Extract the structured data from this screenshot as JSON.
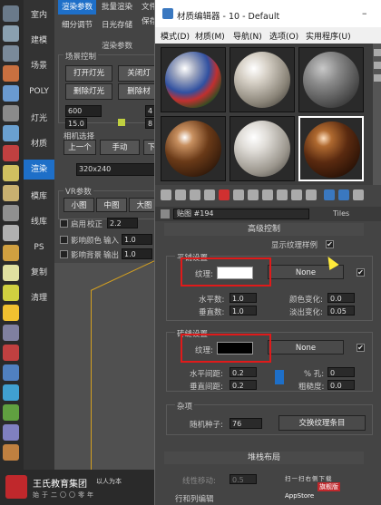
{
  "category_tabs": [
    "室内",
    "建模",
    "场景",
    "POLY",
    "灯光",
    "材质",
    "渲染",
    "模库",
    "线库",
    "PS",
    "复制",
    "清理"
  ],
  "render_panel": {
    "tabs": [
      "渲染参数",
      "批量渲染",
      "文件保存"
    ],
    "subtabs": [
      "细分调节",
      "日光存储"
    ],
    "section_header": "渲染参数",
    "scene_control": "场景控制",
    "btn_open_light": "打开灯光",
    "btn_close_light": "关闭灯",
    "btn_del_light": "删除灯光",
    "btn_del_mat": "删除材",
    "field1": "600",
    "field2": "4",
    "field3": "15.0",
    "field4": "8",
    "camera_select": "相机选择",
    "btn_prev": "上一个",
    "btn_manual": "手动",
    "btn_next": "下",
    "resolution": "320x240",
    "vr_params": "VR参数",
    "btn_small": "小图",
    "btn_medium": "中图",
    "btn_large": "大图",
    "enable_label": "启用",
    "calib_label": "校正",
    "calib_value": "2.2",
    "affect_color": "影响颜色",
    "input_label": "输入",
    "input_value": "1.0",
    "affect_bg": "影响背景",
    "output_label": "输出",
    "output_value": "1.0"
  },
  "material_editor": {
    "title": "材质编辑器 - 10 - Default",
    "menus": [
      "模式(D)",
      "材质(M)",
      "导航(N)",
      "选项(O)",
      "实用程序(U)"
    ],
    "material_name": "贴图 #194",
    "map_type": "Tiles",
    "rollout_title": "高级控制",
    "show_texture_label": "显示纹理样例",
    "show_texture_checked": "✔",
    "tile_settings": {
      "header": "平铺设置",
      "texture_label": "纹理:",
      "texture_color": "#ffffff",
      "map_button": "None",
      "h_count_label": "水平数:",
      "h_count": "1.0",
      "v_count_label": "垂直数:",
      "v_count": "1.0",
      "color_var_label": "颜色变化:",
      "color_var": "0.0",
      "fade_var_label": "淡出变化:",
      "fade_var": "0.05"
    },
    "grout_settings": {
      "header": "砖缝设置",
      "texture_label": "纹理:",
      "texture_color": "#000000",
      "map_button": "None",
      "h_gap_label": "水平间距:",
      "h_gap": "0.2",
      "v_gap_label": "垂直间距:",
      "v_gap": "0.2",
      "holes_label": "% 孔:",
      "holes": "0",
      "rough_label": "粗糙度:",
      "rough": "0.0"
    },
    "misc": {
      "header": "杂项",
      "seed_label": "随机种子:",
      "seed": "76",
      "swap_button": "交换纹理条目"
    },
    "stack_layout": {
      "header": "堆栈布局",
      "line_shift_label": "线性移动:",
      "line_shift": "0.5",
      "row_col_label": "行和列编辑"
    }
  },
  "watermark": {
    "brand": "王氏教育集团",
    "slogan": "以人为本",
    "subline": "始于二〇〇零年",
    "app_lines": [
      "扫一扫右侧下载",
      "旗舰版",
      "AppStore"
    ]
  },
  "colors": {
    "accent": "#1e6fc8",
    "highlight_box": "#e01a1a",
    "cursor": "#ffeb3b"
  }
}
